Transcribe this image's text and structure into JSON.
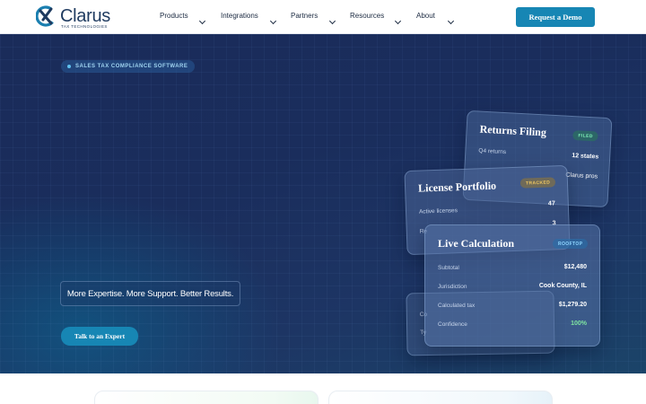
{
  "nav": {
    "logo_name": "Clarus",
    "logo_sub": "TAX TECHNOLOGIES",
    "menu": [
      {
        "label": "Products"
      },
      {
        "label": "Integrations"
      },
      {
        "label": "Partners"
      },
      {
        "label": "Resources"
      },
      {
        "label": "About"
      }
    ],
    "cta": "Request a Demo"
  },
  "hero": {
    "badge": "SALES TAX COMPLIANCE SOFTWARE",
    "tagline": "More Expertise. More Support. Better Results.",
    "cta": "Talk to an Expert"
  },
  "cards": {
    "returns": {
      "title": "Returns Filing",
      "badge": "FILED",
      "rows": [
        {
          "label": "Q4 returns",
          "value": "12 states"
        },
        {
          "label": "",
          "value": "Clarus pros"
        }
      ]
    },
    "license": {
      "title": "License Portfolio",
      "badge": "TRACKED",
      "rows": [
        {
          "label": "Active licenses",
          "value": "47"
        },
        {
          "label": "Re",
          "value": "3"
        }
      ]
    },
    "ghost": {
      "rows": [
        {
          "label": "Co"
        },
        {
          "label": "Ty"
        }
      ]
    },
    "live": {
      "title": "Live Calculation",
      "badge": "ROOFTOP",
      "rows": [
        {
          "label": "Subtotal",
          "value": "$12,480"
        },
        {
          "label": "Jurisdiction",
          "value": "Cook County, IL"
        },
        {
          "label": "Calculated tax",
          "value": "$1,279.20"
        },
        {
          "label": "Confidence",
          "value": "100%"
        }
      ]
    }
  },
  "colors": {
    "accent": "#1786b4",
    "navy": "#1a2c5a",
    "filed_green": "#3fc68a",
    "tracked_amber": "#e0b04a",
    "rooftop_blue": "#6cc4f0",
    "confidence_green": "#7fe3a0"
  }
}
